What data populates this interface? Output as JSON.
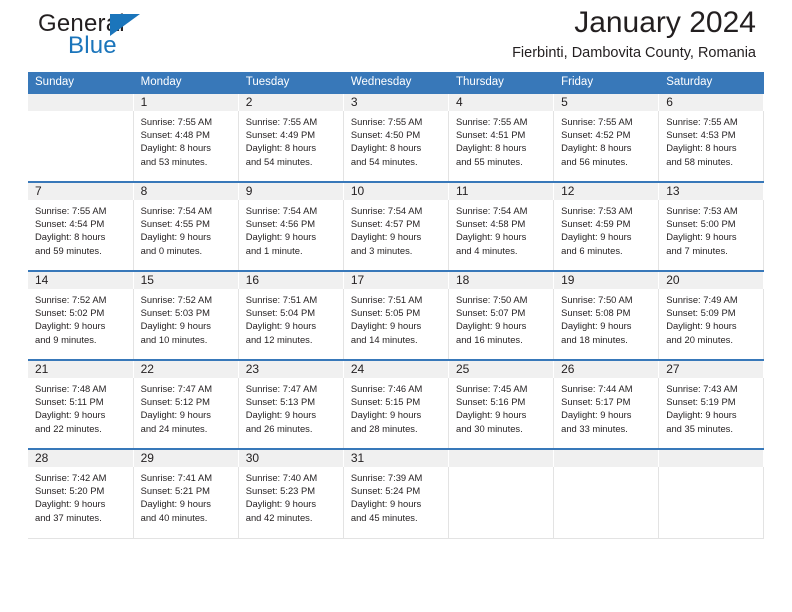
{
  "brand": {
    "name_part1": "General",
    "name_part2": "Blue",
    "accent_color": "#1b75bb"
  },
  "header": {
    "title": "January 2024",
    "location": "Fierbinti, Dambovita County, Romania"
  },
  "theme": {
    "header_row_bg": "#3878b9",
    "daynum_bg": "#f0f0f0",
    "cell_bg": "#ffffff",
    "grid_line": "#e3e3e3",
    "text": "#231f20"
  },
  "calendar": {
    "day_names": [
      "Sunday",
      "Monday",
      "Tuesday",
      "Wednesday",
      "Thursday",
      "Friday",
      "Saturday"
    ],
    "weeks": [
      [
        {
          "day": "",
          "sunrise": "",
          "sunset": "",
          "daylight_1": "",
          "daylight_2": ""
        },
        {
          "day": "1",
          "sunrise": "Sunrise: 7:55 AM",
          "sunset": "Sunset: 4:48 PM",
          "daylight_1": "Daylight: 8 hours",
          "daylight_2": "and 53 minutes."
        },
        {
          "day": "2",
          "sunrise": "Sunrise: 7:55 AM",
          "sunset": "Sunset: 4:49 PM",
          "daylight_1": "Daylight: 8 hours",
          "daylight_2": "and 54 minutes."
        },
        {
          "day": "3",
          "sunrise": "Sunrise: 7:55 AM",
          "sunset": "Sunset: 4:50 PM",
          "daylight_1": "Daylight: 8 hours",
          "daylight_2": "and 54 minutes."
        },
        {
          "day": "4",
          "sunrise": "Sunrise: 7:55 AM",
          "sunset": "Sunset: 4:51 PM",
          "daylight_1": "Daylight: 8 hours",
          "daylight_2": "and 55 minutes."
        },
        {
          "day": "5",
          "sunrise": "Sunrise: 7:55 AM",
          "sunset": "Sunset: 4:52 PM",
          "daylight_1": "Daylight: 8 hours",
          "daylight_2": "and 56 minutes."
        },
        {
          "day": "6",
          "sunrise": "Sunrise: 7:55 AM",
          "sunset": "Sunset: 4:53 PM",
          "daylight_1": "Daylight: 8 hours",
          "daylight_2": "and 58 minutes."
        }
      ],
      [
        {
          "day": "7",
          "sunrise": "Sunrise: 7:55 AM",
          "sunset": "Sunset: 4:54 PM",
          "daylight_1": "Daylight: 8 hours",
          "daylight_2": "and 59 minutes."
        },
        {
          "day": "8",
          "sunrise": "Sunrise: 7:54 AM",
          "sunset": "Sunset: 4:55 PM",
          "daylight_1": "Daylight: 9 hours",
          "daylight_2": "and 0 minutes."
        },
        {
          "day": "9",
          "sunrise": "Sunrise: 7:54 AM",
          "sunset": "Sunset: 4:56 PM",
          "daylight_1": "Daylight: 9 hours",
          "daylight_2": "and 1 minute."
        },
        {
          "day": "10",
          "sunrise": "Sunrise: 7:54 AM",
          "sunset": "Sunset: 4:57 PM",
          "daylight_1": "Daylight: 9 hours",
          "daylight_2": "and 3 minutes."
        },
        {
          "day": "11",
          "sunrise": "Sunrise: 7:54 AM",
          "sunset": "Sunset: 4:58 PM",
          "daylight_1": "Daylight: 9 hours",
          "daylight_2": "and 4 minutes."
        },
        {
          "day": "12",
          "sunrise": "Sunrise: 7:53 AM",
          "sunset": "Sunset: 4:59 PM",
          "daylight_1": "Daylight: 9 hours",
          "daylight_2": "and 6 minutes."
        },
        {
          "day": "13",
          "sunrise": "Sunrise: 7:53 AM",
          "sunset": "Sunset: 5:00 PM",
          "daylight_1": "Daylight: 9 hours",
          "daylight_2": "and 7 minutes."
        }
      ],
      [
        {
          "day": "14",
          "sunrise": "Sunrise: 7:52 AM",
          "sunset": "Sunset: 5:02 PM",
          "daylight_1": "Daylight: 9 hours",
          "daylight_2": "and 9 minutes."
        },
        {
          "day": "15",
          "sunrise": "Sunrise: 7:52 AM",
          "sunset": "Sunset: 5:03 PM",
          "daylight_1": "Daylight: 9 hours",
          "daylight_2": "and 10 minutes."
        },
        {
          "day": "16",
          "sunrise": "Sunrise: 7:51 AM",
          "sunset": "Sunset: 5:04 PM",
          "daylight_1": "Daylight: 9 hours",
          "daylight_2": "and 12 minutes."
        },
        {
          "day": "17",
          "sunrise": "Sunrise: 7:51 AM",
          "sunset": "Sunset: 5:05 PM",
          "daylight_1": "Daylight: 9 hours",
          "daylight_2": "and 14 minutes."
        },
        {
          "day": "18",
          "sunrise": "Sunrise: 7:50 AM",
          "sunset": "Sunset: 5:07 PM",
          "daylight_1": "Daylight: 9 hours",
          "daylight_2": "and 16 minutes."
        },
        {
          "day": "19",
          "sunrise": "Sunrise: 7:50 AM",
          "sunset": "Sunset: 5:08 PM",
          "daylight_1": "Daylight: 9 hours",
          "daylight_2": "and 18 minutes."
        },
        {
          "day": "20",
          "sunrise": "Sunrise: 7:49 AM",
          "sunset": "Sunset: 5:09 PM",
          "daylight_1": "Daylight: 9 hours",
          "daylight_2": "and 20 minutes."
        }
      ],
      [
        {
          "day": "21",
          "sunrise": "Sunrise: 7:48 AM",
          "sunset": "Sunset: 5:11 PM",
          "daylight_1": "Daylight: 9 hours",
          "daylight_2": "and 22 minutes."
        },
        {
          "day": "22",
          "sunrise": "Sunrise: 7:47 AM",
          "sunset": "Sunset: 5:12 PM",
          "daylight_1": "Daylight: 9 hours",
          "daylight_2": "and 24 minutes."
        },
        {
          "day": "23",
          "sunrise": "Sunrise: 7:47 AM",
          "sunset": "Sunset: 5:13 PM",
          "daylight_1": "Daylight: 9 hours",
          "daylight_2": "and 26 minutes."
        },
        {
          "day": "24",
          "sunrise": "Sunrise: 7:46 AM",
          "sunset": "Sunset: 5:15 PM",
          "daylight_1": "Daylight: 9 hours",
          "daylight_2": "and 28 minutes."
        },
        {
          "day": "25",
          "sunrise": "Sunrise: 7:45 AM",
          "sunset": "Sunset: 5:16 PM",
          "daylight_1": "Daylight: 9 hours",
          "daylight_2": "and 30 minutes."
        },
        {
          "day": "26",
          "sunrise": "Sunrise: 7:44 AM",
          "sunset": "Sunset: 5:17 PM",
          "daylight_1": "Daylight: 9 hours",
          "daylight_2": "and 33 minutes."
        },
        {
          "day": "27",
          "sunrise": "Sunrise: 7:43 AM",
          "sunset": "Sunset: 5:19 PM",
          "daylight_1": "Daylight: 9 hours",
          "daylight_2": "and 35 minutes."
        }
      ],
      [
        {
          "day": "28",
          "sunrise": "Sunrise: 7:42 AM",
          "sunset": "Sunset: 5:20 PM",
          "daylight_1": "Daylight: 9 hours",
          "daylight_2": "and 37 minutes."
        },
        {
          "day": "29",
          "sunrise": "Sunrise: 7:41 AM",
          "sunset": "Sunset: 5:21 PM",
          "daylight_1": "Daylight: 9 hours",
          "daylight_2": "and 40 minutes."
        },
        {
          "day": "30",
          "sunrise": "Sunrise: 7:40 AM",
          "sunset": "Sunset: 5:23 PM",
          "daylight_1": "Daylight: 9 hours",
          "daylight_2": "and 42 minutes."
        },
        {
          "day": "31",
          "sunrise": "Sunrise: 7:39 AM",
          "sunset": "Sunset: 5:24 PM",
          "daylight_1": "Daylight: 9 hours",
          "daylight_2": "and 45 minutes."
        },
        {
          "day": "",
          "sunrise": "",
          "sunset": "",
          "daylight_1": "",
          "daylight_2": ""
        },
        {
          "day": "",
          "sunrise": "",
          "sunset": "",
          "daylight_1": "",
          "daylight_2": ""
        },
        {
          "day": "",
          "sunrise": "",
          "sunset": "",
          "daylight_1": "",
          "daylight_2": ""
        }
      ]
    ]
  }
}
